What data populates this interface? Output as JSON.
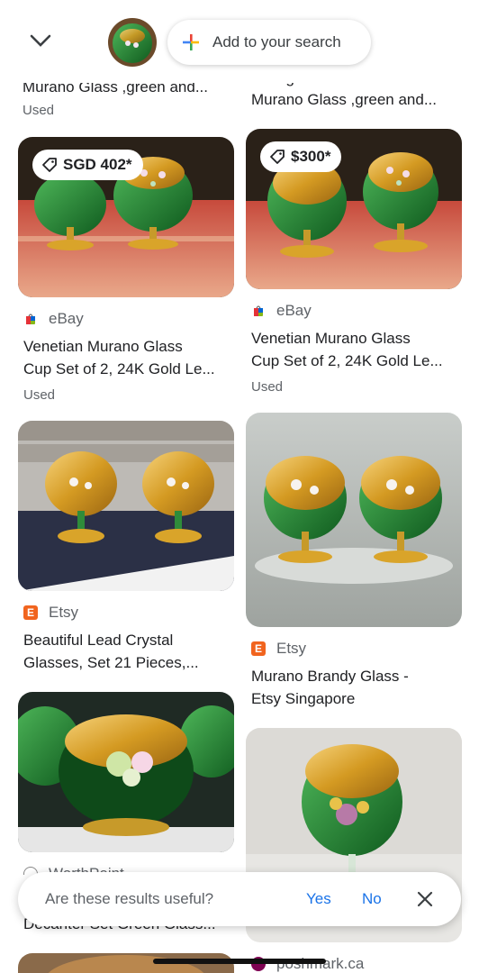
{
  "header": {
    "back_icon": "chevron-down-icon",
    "add_search_label": "Add to your search"
  },
  "left_col": {
    "partial_top": {
      "title": "Murano Glass ,green and...",
      "condition": "Used"
    },
    "card1": {
      "price": "SGD 402*",
      "source": "eBay",
      "title_line1": "Venetian Murano Glass",
      "title_line2": "Cup Set of 2, 24K Gold Le...",
      "condition": "Used"
    },
    "card2": {
      "source": "Etsy",
      "title_line1": "Beautiful Lead Crystal",
      "title_line2": "Glasses, Set 21 Pieces,..."
    },
    "card3": {
      "source": "WorthPoint",
      "title_line2": "Decanter Set Green Glass..."
    }
  },
  "right_col": {
    "partial_top": {
      "title_line1": "Vintage Hand Made",
      "title_line2": "Murano Glass ,green and..."
    },
    "card1": {
      "price": "$300*",
      "source": "eBay",
      "title_line1": "Venetian Murano Glass",
      "title_line2": "Cup Set of 2, 24K Gold Le...",
      "condition": "Used"
    },
    "card2": {
      "source": "Etsy",
      "title_line1": "Murano Brandy Glass -",
      "title_line2": "Etsy Singapore"
    },
    "card3": {
      "source": "poshmark.ca"
    }
  },
  "feedback": {
    "question": "Are these results useful?",
    "yes": "Yes",
    "no": "No"
  },
  "colors": {
    "link_blue": "#1a73e8",
    "etsy_orange": "#f1641e",
    "glass_green": "#1f7a2e",
    "gold": "#d9a42a"
  }
}
